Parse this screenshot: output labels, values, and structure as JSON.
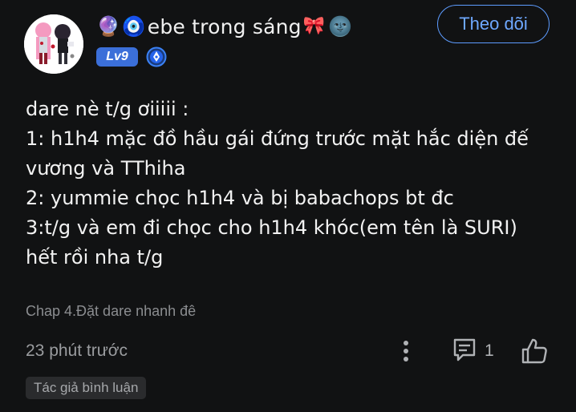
{
  "user": {
    "name": "ebe trong sáng",
    "prefix_emojis": [
      "🔮",
      "🧿"
    ],
    "suffix_emojis": [
      "🎀",
      "🌚"
    ],
    "level": "Lv9"
  },
  "follow_label": "Theo dõi",
  "comment": {
    "lines": [
      "dare nè t/g ơiiiii :",
      "1: h1h4 mặc đồ hầu gái đứng trước mặt hắc diện đế",
      "vương và TThiha",
      "2: yummie chọc h1h4 và bị babachops bt đc",
      "3:t/g và em đi chọc cho h1h4 khóc(em tên là SURI)",
      "hết rồi nha t/g"
    ]
  },
  "chapter_ref": "Chap 4.Đặt dare nhanh đê",
  "timestamp": "23 phút trước",
  "reply_count": "1",
  "author_tag": "Tác giả bình luận",
  "colors": {
    "background": "#111213",
    "accent": "#5d9cff",
    "level_badge": "#3b6fd9"
  },
  "icons": {
    "more": "more-vertical-icon",
    "reply": "comment-reply-icon",
    "like": "thumbs-up-icon",
    "author_badge": "pen-nib-badge-icon"
  }
}
